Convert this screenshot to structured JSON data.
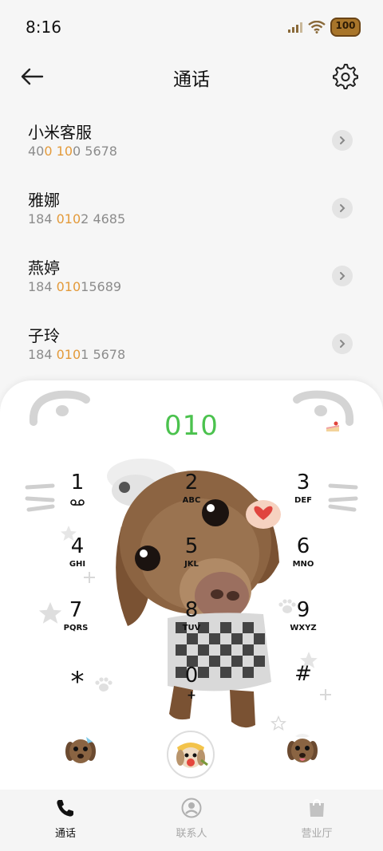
{
  "status_bar": {
    "time": "8:16",
    "battery_level": "100",
    "icons": [
      "signal-icon",
      "wifi-icon",
      "battery-icon"
    ]
  },
  "header": {
    "title": "通话",
    "back_icon": "arrow-left-icon",
    "settings_icon": "gear-icon"
  },
  "colors": {
    "match_highlight": "#e39a3a",
    "dialed_number": "#4bc24e",
    "panel_background": "#ffffff",
    "page_background": "#f6f6f6"
  },
  "contacts": [
    {
      "name": "小米客服",
      "number_parts": [
        "40",
        "0",
        " ",
        "10",
        "0 5678"
      ]
    },
    {
      "name": "雅娜",
      "number_parts": [
        "184 ",
        "010",
        "2 4685"
      ]
    },
    {
      "name": "燕婷",
      "number_parts": [
        "184 ",
        "010",
        "15689"
      ]
    },
    {
      "name": "子玲",
      "number_parts": [
        "184 ",
        "010",
        "1 5678"
      ]
    }
  ],
  "dialer": {
    "dialed_number": "010",
    "keys": [
      {
        "digit": "1",
        "letters": ""
      },
      {
        "digit": "2",
        "letters": "ABC"
      },
      {
        "digit": "3",
        "letters": "DEF"
      },
      {
        "digit": "4",
        "letters": "GHI"
      },
      {
        "digit": "5",
        "letters": "JKL"
      },
      {
        "digit": "6",
        "letters": "MNO"
      },
      {
        "digit": "7",
        "letters": "PQRS"
      },
      {
        "digit": "8",
        "letters": "TUV"
      },
      {
        "digit": "9",
        "letters": "WXYZ"
      },
      {
        "digit": "*",
        "letters": ""
      },
      {
        "digit": "0",
        "letters": "+"
      },
      {
        "digit": "#",
        "letters": ""
      }
    ]
  },
  "bottom_nav": {
    "items": [
      {
        "label": "通话",
        "icon": "phone-icon",
        "active": true
      },
      {
        "label": "联系人",
        "icon": "contact-icon",
        "active": false
      },
      {
        "label": "营业厅",
        "icon": "shopping-bag-icon",
        "active": false
      }
    ]
  }
}
